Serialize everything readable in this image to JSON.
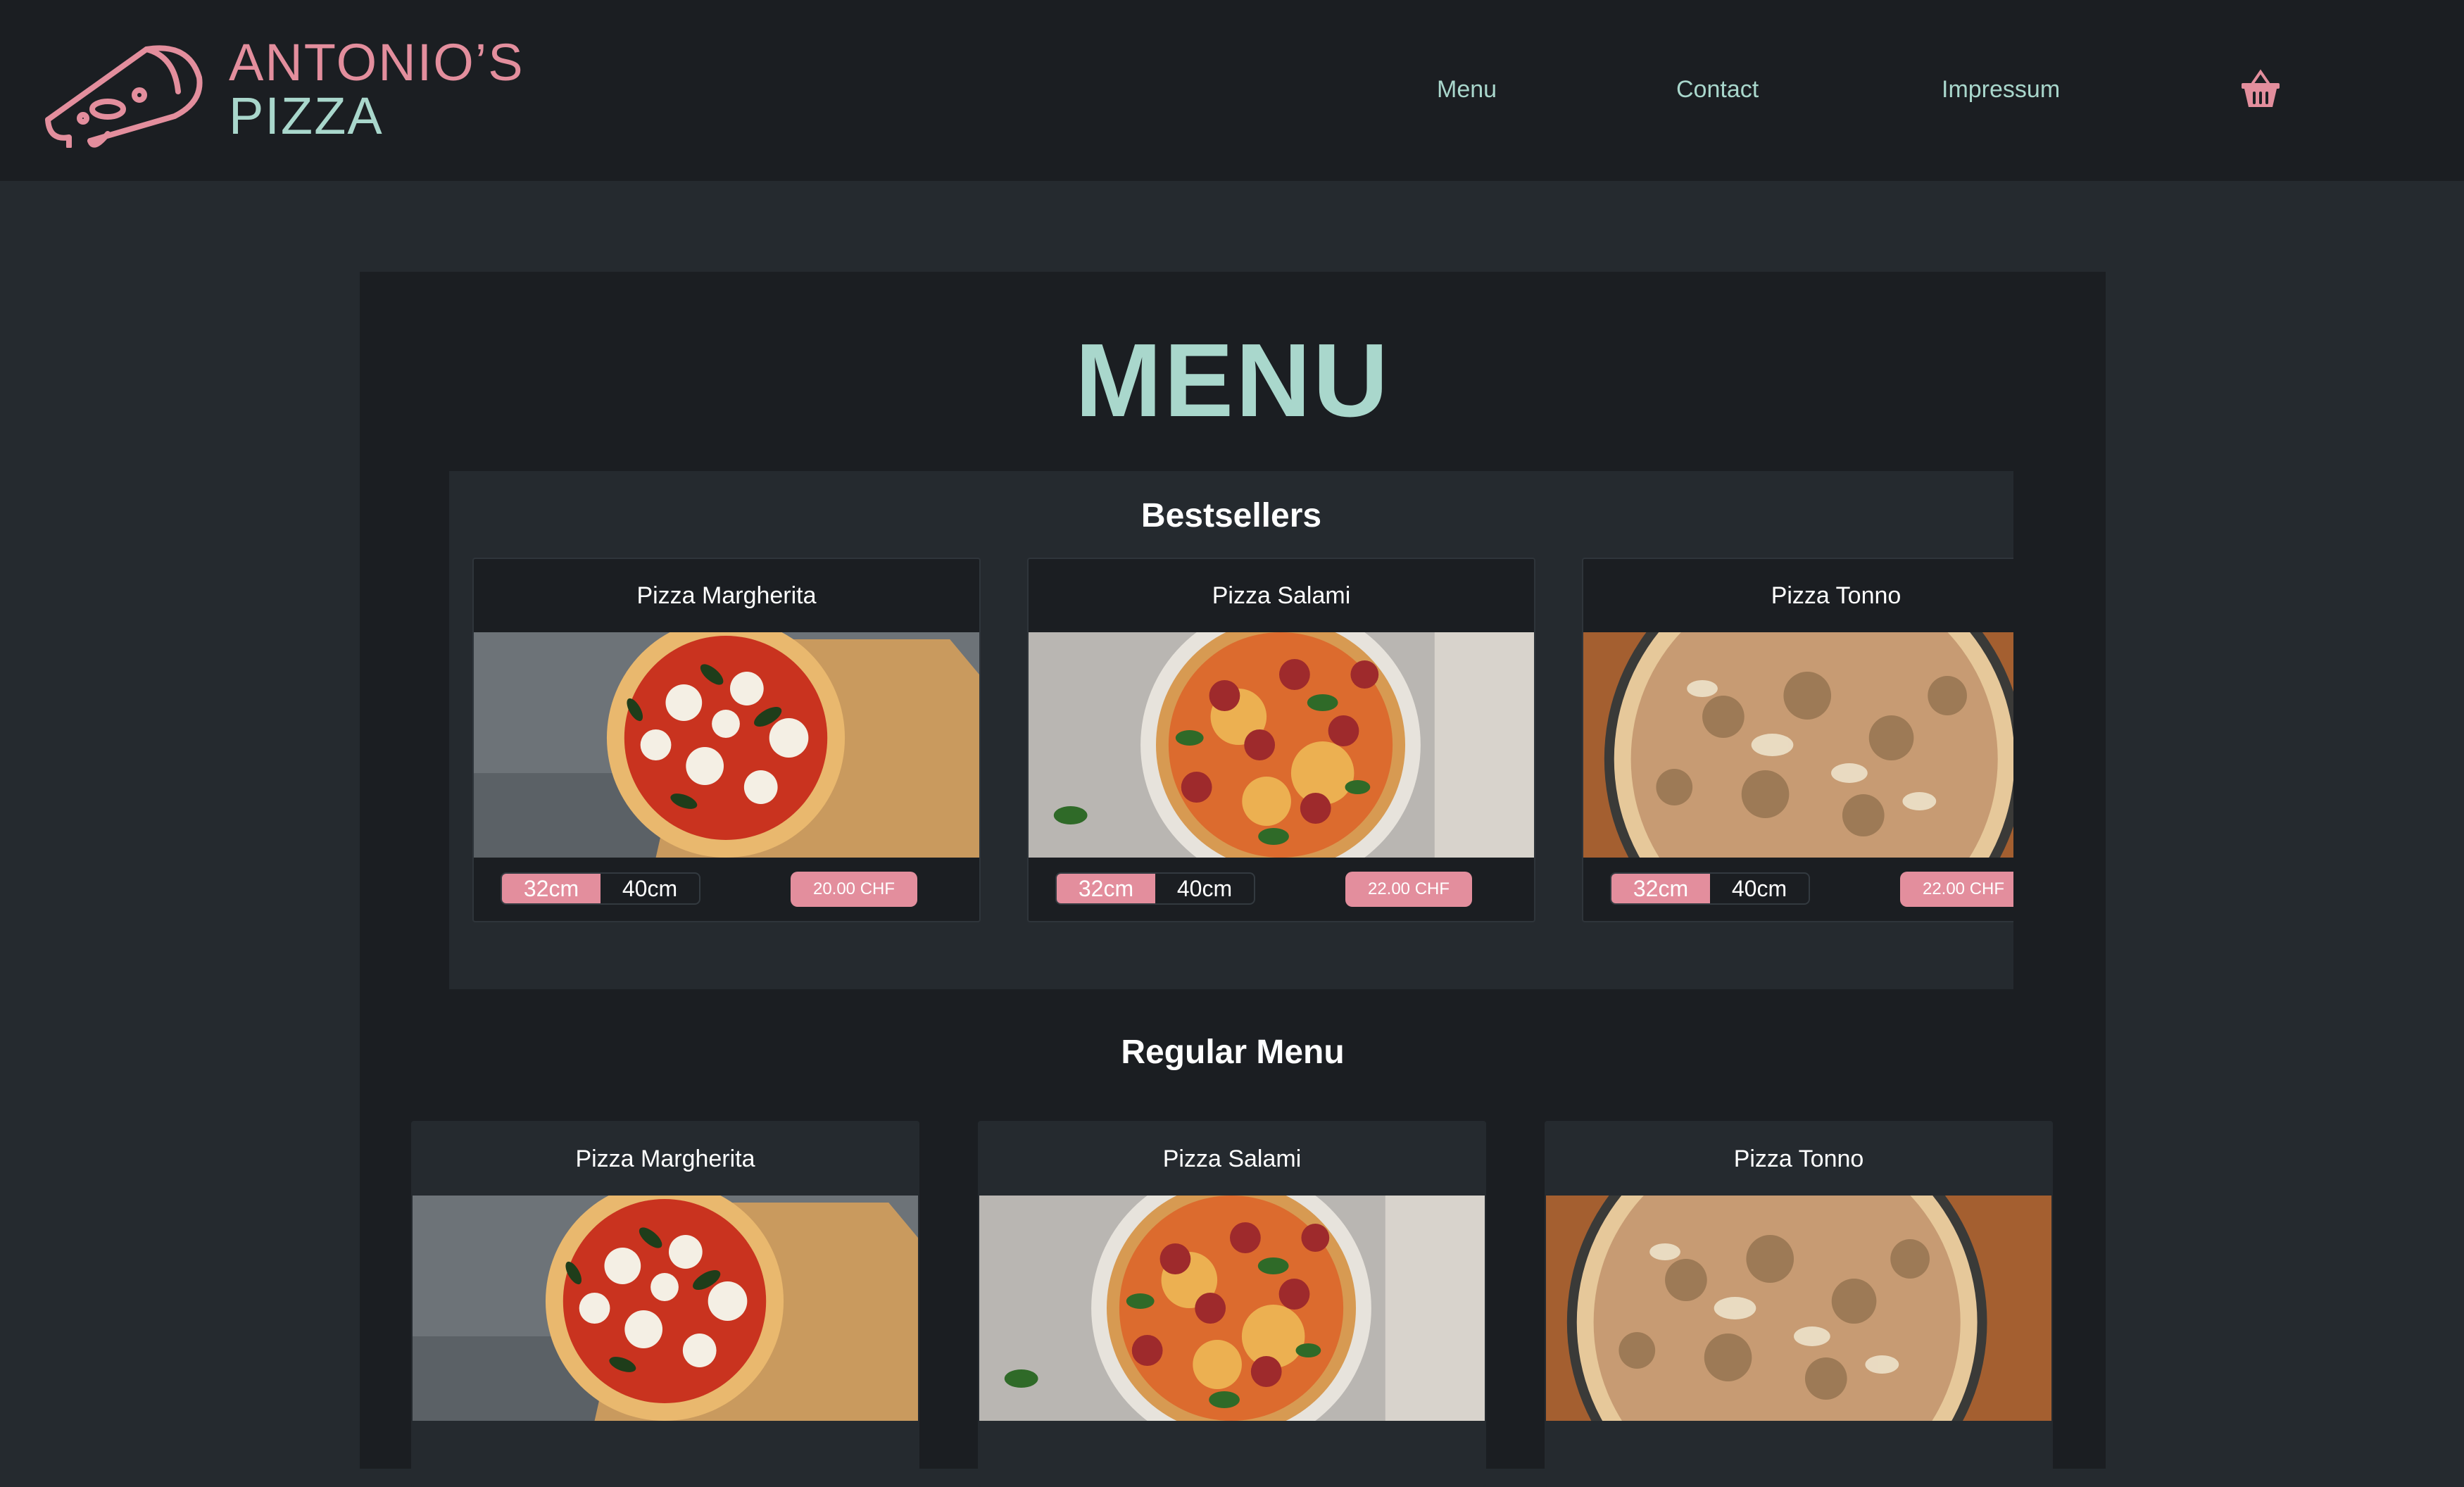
{
  "brand": {
    "line1": "ANTONIO’S",
    "line2": "PIZZA"
  },
  "nav": {
    "menu": "Menu",
    "contact": "Contact",
    "impressum": "Impressum"
  },
  "page_title": "MENU",
  "bestsellers": {
    "heading": "Bestsellers",
    "cards": [
      {
        "title": "Pizza Margherita",
        "size_small": "32cm",
        "size_large": "40cm",
        "price": "20.00 CHF"
      },
      {
        "title": "Pizza Salami",
        "size_small": "32cm",
        "size_large": "40cm",
        "price": "22.00 CHF"
      },
      {
        "title": "Pizza Tonno",
        "size_small": "32cm",
        "size_large": "40cm",
        "price": "22.00 CHF"
      }
    ]
  },
  "regular_menu": {
    "heading": "Regular Menu",
    "cards": [
      {
        "title": "Pizza Margherita"
      },
      {
        "title": "Pizza Salami"
      },
      {
        "title": "Pizza Tonno"
      }
    ]
  },
  "colors": {
    "header_bg": "#1b1e22",
    "page_bg": "#252a2f",
    "accent_pink": "#e38e9d",
    "accent_mint": "#a9d7cc"
  },
  "icons": {
    "logo": "pizza-slice-icon",
    "cart": "basket-icon"
  }
}
